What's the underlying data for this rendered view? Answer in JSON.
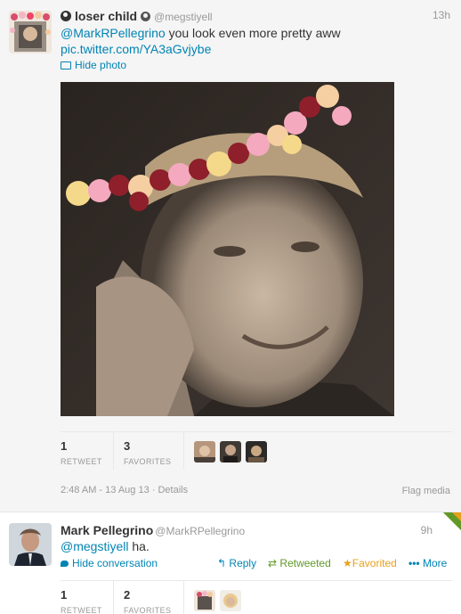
{
  "tweet1": {
    "display_name": "loser child",
    "handle": "@megstiyell",
    "time": "13h",
    "mention": "@MarkRPellegrino",
    "text_after_mention": " you look even more pretty aww",
    "link": "pic.twitter.com/YA3aGvjybe",
    "hide_photo_label": "Hide photo",
    "retweets_count": "1",
    "retweets_label": "RETWEET",
    "favorites_count": "3",
    "favorites_label": "FAVORITES",
    "timestamp": "2:48 AM - 13 Aug 13",
    "details_label": "Details",
    "timestamp_separator": " · ",
    "flag_label": "Flag media"
  },
  "tweet2": {
    "display_name": "Mark Pellegrino",
    "handle": "@MarkRPellegrino",
    "time": "9h",
    "mention": "@megstiyell",
    "text_after_mention": " ha.",
    "hide_conversation_label": "Hide conversation",
    "reply_label": "Reply",
    "retweeted_label": "Retweeted",
    "favorited_label": "Favorited",
    "more_label": "More",
    "retweets_count": "1",
    "retweets_label": "RETWEET",
    "favorites_count": "2",
    "favorites_label": "FAVORITES"
  },
  "icons": {
    "reply": "reply-arrow-icon",
    "retweet": "retweet-icon",
    "favorite": "star-icon",
    "more": "more-dots-icon",
    "photo": "photo-icon",
    "conversation": "conversation-bubble-icon",
    "corner": "retweeted-favorited-corner-icon"
  },
  "colors": {
    "link": "#0084b4",
    "retweeted": "#609928",
    "favorited": "#e8a01c",
    "muted": "#999999",
    "text": "#333333"
  }
}
